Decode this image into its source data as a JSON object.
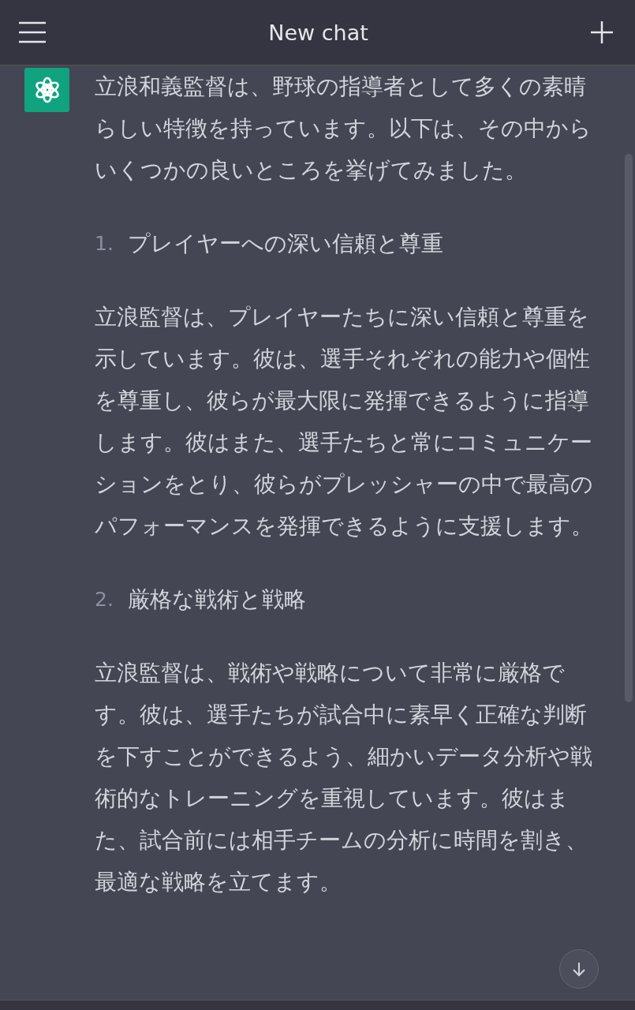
{
  "header": {
    "title": "New chat"
  },
  "message": {
    "blocks": [
      {
        "kind": "paragraph",
        "text": "立浪和義監督は、野球の指導者として多くの素晴らしい特徴を持っています。以下は、その中からいくつかの良いところを挙げてみました。"
      },
      {
        "kind": "list_item",
        "number": "1.",
        "text": "プレイヤーへの深い信頼と尊重"
      },
      {
        "kind": "paragraph",
        "text": "立浪監督は、プレイヤーたちに深い信頼と尊重を示しています。彼は、選手それぞれの能力や個性を尊重し、彼らが最大限に発揮できるように指導します。彼はまた、選手たちと常にコミュニケーションをとり、彼らがプレッシャーの中で最高のパフォーマンスを発揮できるように支援します。"
      },
      {
        "kind": "list_item",
        "number": "2.",
        "text": "厳格な戦術と戦略"
      },
      {
        "kind": "paragraph",
        "text": "立浪監督は、戦術や戦略について非常に厳格です。彼は、選手たちが試合中に素早く正確な判断を下すことができるよう、細かいデータ分析や戦術的なトレーニングを重視しています。彼はまた、試合前には相手チームの分析に時間を割き、最適な戦略を立てます。"
      }
    ]
  }
}
